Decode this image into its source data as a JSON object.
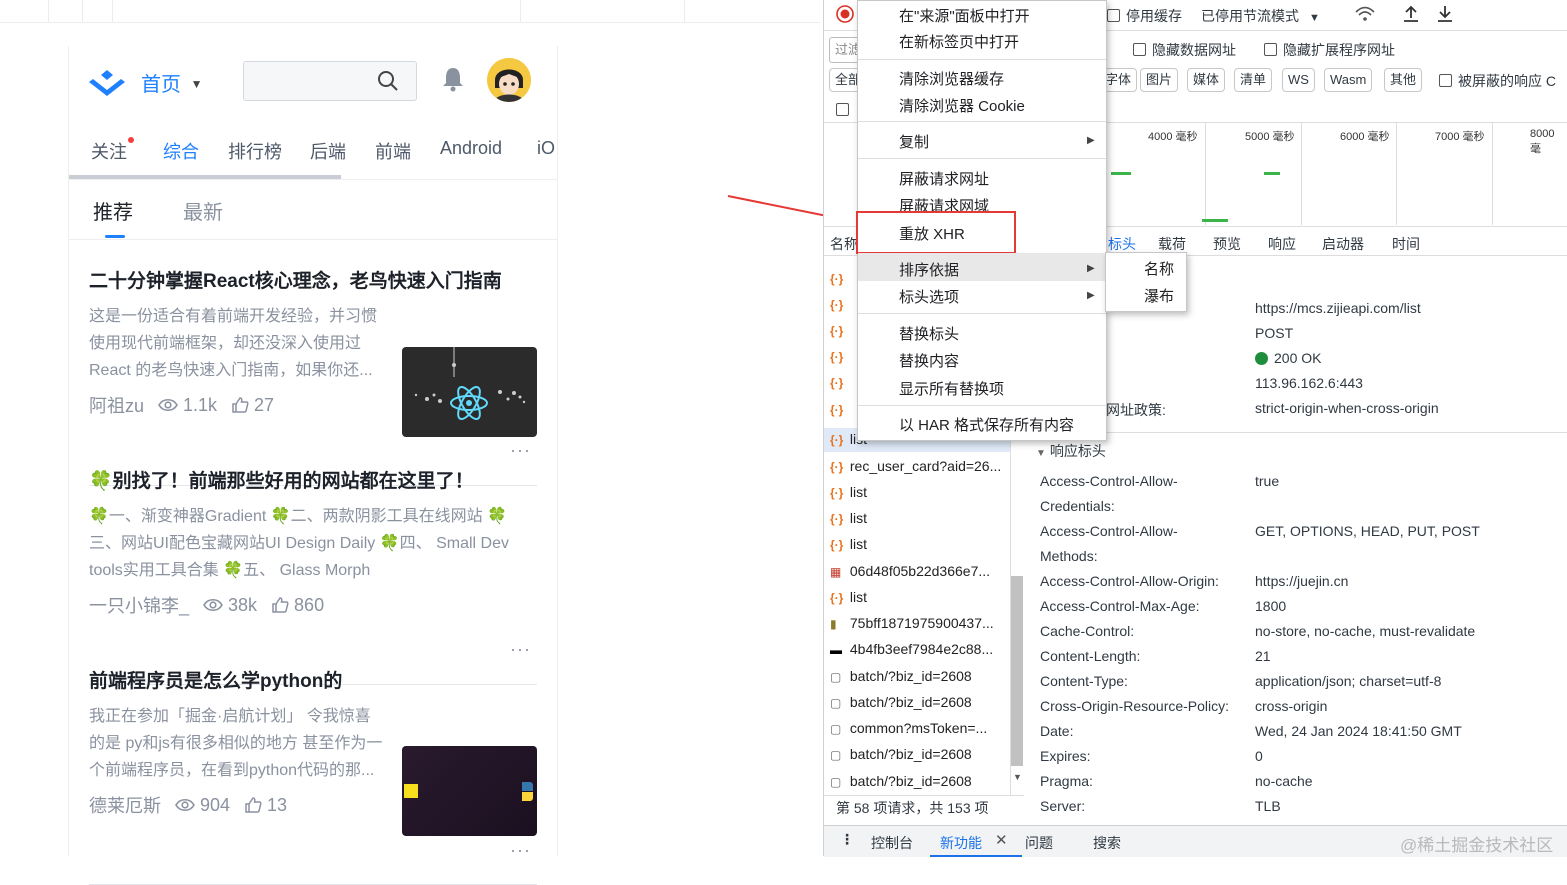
{
  "site": {
    "home_label": "首页",
    "nav_tabs": [
      "关注",
      "综合",
      "排行榜",
      "后端",
      "前端",
      "Android",
      "iO"
    ],
    "active_nav": "综合",
    "sub_tabs": [
      "推荐",
      "最新"
    ],
    "articles": [
      {
        "title": "二十分钟掌握React核心理念，老鸟快速入门指南",
        "body": [
          "这是一份适合有着前端开发经验，并习惯",
          "使用现代前端框架，却还没深入使用过",
          "React 的老鸟快速入门指南，如果你还..."
        ],
        "author": "阿祖zu",
        "views": "1.1k",
        "likes": "27"
      },
      {
        "title": "🍀别找了！前端那些好用的网站都在这里了！",
        "body": [
          "🍀一、渐变神器Gradient 🍀二、两款阴影工具在线网站 🍀",
          "三、网站UI配色宝藏网站UI Design Daily 🍀四、 Small Dev",
          "tools实用工具合集 🍀五、 Glass Morph"
        ],
        "author": "一只小锦李_",
        "views": "38k",
        "likes": "860"
      },
      {
        "title": "前端程序员是怎么学python的",
        "body": [
          "我正在参加「掘金·启航计划」 令我惊喜",
          "的是 py和js有很多相似的地方 甚至作为一",
          "个前端程序员，在看到python代码的那..."
        ],
        "author": "德莱厄斯",
        "views": "904",
        "likes": "13"
      }
    ]
  },
  "devtools": {
    "toolbar": {
      "disable_cache": "停用缓存",
      "throttle": "已停用节流模式"
    },
    "filter_placeholder": "过滤",
    "hide_data_urls": "隐藏数据网址",
    "hide_extension_urls": "隐藏扩展程序网址",
    "type_filters": [
      "全部",
      "字体",
      "图片",
      "媒体",
      "清单",
      "WS",
      "Wasm",
      "其他"
    ],
    "blocked_responses": "被屏蔽的响应 C",
    "timeline_ticks": [
      "4000 毫秒",
      "5000 毫秒",
      "6000 毫秒",
      "7000 毫秒",
      "8000 毫"
    ],
    "name_col": "名称",
    "detail_tabs": [
      "标头",
      "载荷",
      "预览",
      "响应",
      "启动器",
      "时间"
    ],
    "requests": [
      "list",
      "rec_user_card?aid=26...",
      "list",
      "list",
      "list",
      "06d48f05b22d366e7...",
      "list",
      "75bff1871975900437...",
      "4b4fb3eef7984e2c88...",
      "batch/?biz_id=2608",
      "batch/?biz_id=2608",
      "common?msToken=...",
      "batch/?biz_id=2608",
      "batch/?biz_id=2608"
    ],
    "general": {
      "url": "https://mcs.zijieapi.com/list",
      "method": "POST",
      "status": "200 OK",
      "remote": "113.96.162.6:443",
      "referrer_key": "网址政策:",
      "referrer": "strict-origin-when-cross-origin"
    },
    "response_headers_title": "响应标头",
    "headers": [
      [
        "Access-Control-Allow-",
        "true"
      ],
      [
        "Credentials:",
        ""
      ],
      [
        "Access-Control-Allow-",
        "GET, OPTIONS, HEAD, PUT, POST"
      ],
      [
        "Methods:",
        ""
      ],
      [
        "Access-Control-Allow-Origin:",
        "https://juejin.cn"
      ],
      [
        "Access-Control-Max-Age:",
        "1800"
      ],
      [
        "Cache-Control:",
        "no-store, no-cache, must-revalidate"
      ],
      [
        "Content-Length:",
        "21"
      ],
      [
        "Content-Type:",
        "application/json; charset=utf-8"
      ],
      [
        "Cross-Origin-Resource-Policy:",
        "cross-origin"
      ],
      [
        "Date:",
        "Wed, 24 Jan 2024 18:41:50 GMT"
      ],
      [
        "Expires:",
        "0"
      ],
      [
        "Pragma:",
        "no-cache"
      ],
      [
        "Server:",
        "TLB"
      ]
    ],
    "status_bar": "第 58 项请求，共 153 项",
    "drawer_tabs": [
      "控制台",
      "新功能",
      "问题",
      "搜索"
    ],
    "watermark": "@稀土掘金技术社区"
  },
  "context_menu": {
    "items": [
      "在\"来源\"面板中打开",
      "在新标签页中打开",
      "清除浏览器缓存",
      "清除浏览器 Cookie",
      "复制",
      "屏蔽请求网址",
      "屏蔽请求网域",
      "重放 XHR",
      "排序依据",
      "标头选项",
      "替换标头",
      "替换内容",
      "显示所有替换项",
      "以 HAR 格式保存所有内容"
    ],
    "submenu": [
      "名称",
      "瀑布"
    ]
  },
  "colors": {
    "accent": "#1e80ff",
    "highlight_box": "#e53935",
    "status_ok": "#1e8e3e"
  }
}
